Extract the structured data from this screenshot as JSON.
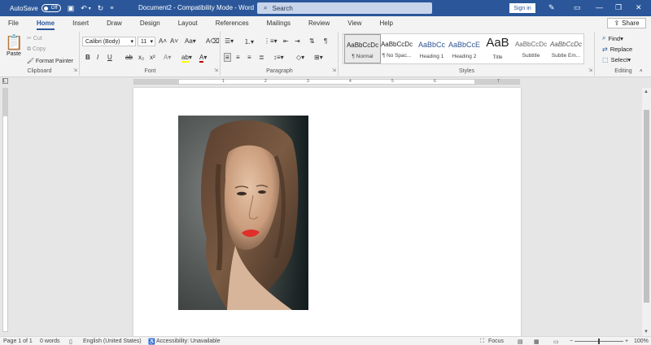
{
  "titlebar": {
    "autosave_label": "AutoSave",
    "autosave_state": "Off",
    "doc_title": "Document2  -  Compatibility Mode  -  Word",
    "search_placeholder": "Search",
    "signin_label": "Sign in"
  },
  "tabs": [
    "File",
    "Home",
    "Insert",
    "Draw",
    "Design",
    "Layout",
    "References",
    "Mailings",
    "Review",
    "View",
    "Help"
  ],
  "active_tab": "Home",
  "share_label": "Share",
  "clipboard": {
    "paste": "Paste",
    "cut": "Cut",
    "copy": "Copy",
    "format_painter": "Format Painter",
    "group_label": "Clipboard"
  },
  "font": {
    "family": "Calibri (Body)",
    "size": "11",
    "group_label": "Font"
  },
  "paragraph": {
    "group_label": "Paragraph"
  },
  "styles": {
    "group_label": "Styles",
    "items": [
      {
        "preview": "AaBbCcDc",
        "name": "¶ Normal"
      },
      {
        "preview": "AaBbCcDc",
        "name": "¶ No Spac..."
      },
      {
        "preview": "AaBbCc",
        "name": "Heading 1"
      },
      {
        "preview": "AaBbCcE",
        "name": "Heading 2"
      },
      {
        "preview": "AaB",
        "name": "Title"
      },
      {
        "preview": "AaBbCcDc",
        "name": "Subtitle"
      },
      {
        "preview": "AaBbCcDc",
        "name": "Subtle Em..."
      }
    ]
  },
  "editing": {
    "find": "Find",
    "replace": "Replace",
    "select": "Select",
    "group_label": "Editing"
  },
  "ruler_numbers": [
    "1",
    "2",
    "3",
    "4",
    "5",
    "6",
    "7"
  ],
  "statusbar": {
    "page": "Page 1 of 1",
    "words": "0 words",
    "language": "English (United States)",
    "accessibility": "Accessibility: Unavailable",
    "focus": "Focus",
    "zoom": "100%"
  },
  "colors": {
    "brand": "#2b579a",
    "highlight": "#ffff00",
    "font_color": "#c00000"
  }
}
